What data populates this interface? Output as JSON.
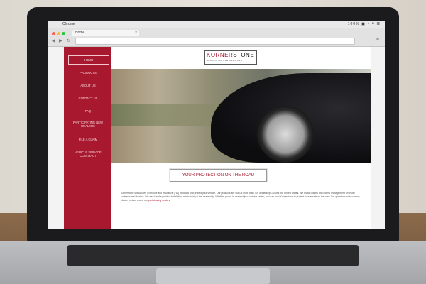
{
  "os_menubar": {
    "apple": "",
    "app_name": "Chrome",
    "status": "100% ▣ ◔ ⚲ ☰"
  },
  "browser": {
    "tab_title": "Home",
    "tab_close": "×",
    "nav_back": "◀",
    "nav_forward": "▶",
    "reload": "↻",
    "url": "",
    "menu": "≡",
    "traffic_lights": [
      "#ff5f57",
      "#febc2e",
      "#28c840"
    ]
  },
  "site": {
    "logo_main_a": "KORNER",
    "logo_main_b": "STONE",
    "logo_sub": "ADMINISTRATIVE SERVICES",
    "brand_color": "#a8182e",
    "nav": [
      {
        "label": "HOME"
      },
      {
        "label": "PRODUCTS"
      },
      {
        "label": "ABOUT US"
      },
      {
        "label": "CONTACT US"
      },
      {
        "label": "FAQ"
      },
      {
        "label": "PARTICIPATING NEW DEALERS"
      },
      {
        "label": "FILE A CLAIM"
      },
      {
        "label": "VEHICLE SERVICE CONTRACT"
      }
    ],
    "cta_label": "YOUR PROTECTION ON THE ROAD",
    "body_text": "Kornerstone specializes in finance and insurance (F&I) products that protect your vehicle. Our products are sold at more than 700 dealerships across the United States. We match claims and claims management for those contracts and dealers. We also handle product installation and training at the dealership. Whether you're in dealership or service center, you can trust Kornerstone to protect your assets on the road. For questions or to contact, please contact one of our",
    "body_link": "participating dealers"
  }
}
